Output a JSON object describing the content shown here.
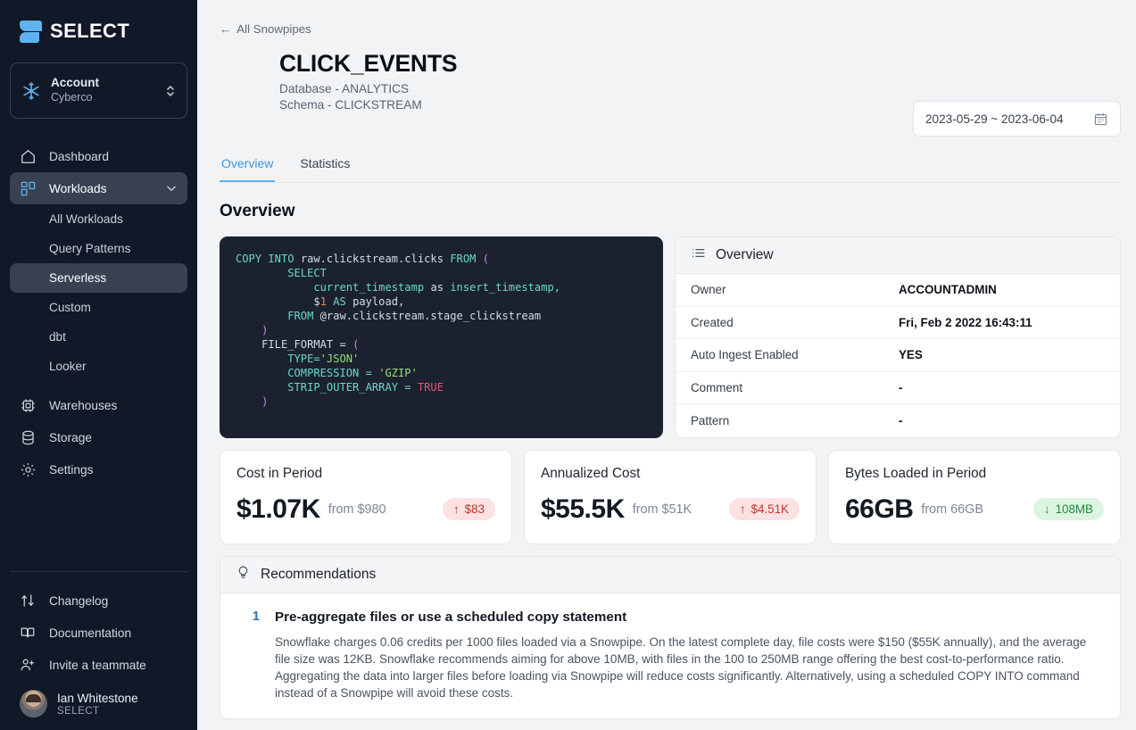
{
  "sidebar": {
    "brand": "SELECT",
    "account": {
      "title": "Account",
      "name": "Cyberco"
    },
    "nav": [
      {
        "label": "Dashboard",
        "icon": "home-icon"
      },
      {
        "label": "Workloads",
        "icon": "workloads-icon"
      }
    ],
    "workload_children": [
      {
        "label": "All Workloads"
      },
      {
        "label": "Query Patterns"
      },
      {
        "label": "Serverless"
      },
      {
        "label": "Custom"
      },
      {
        "label": "dbt"
      },
      {
        "label": "Looker"
      }
    ],
    "nav_rest": [
      {
        "label": "Warehouses",
        "icon": "chip-icon"
      },
      {
        "label": "Storage",
        "icon": "database-icon"
      },
      {
        "label": "Settings",
        "icon": "gear-icon"
      }
    ],
    "footer": [
      {
        "label": "Changelog",
        "icon": "updown-arrows-icon"
      },
      {
        "label": "Documentation",
        "icon": "book-icon"
      },
      {
        "label": "Invite a teammate",
        "icon": "user-plus-icon"
      }
    ],
    "user": {
      "name": "Ian Whitestone",
      "org": "SELECT"
    }
  },
  "header": {
    "back_label": "All Snowpipes",
    "title": "CLICK_EVENTS",
    "database_line": "Database - ANALYTICS",
    "schema_line": "Schema - CLICKSTREAM",
    "date_range": "2023-05-29 ~ 2023-06-04"
  },
  "tabs": [
    {
      "label": "Overview",
      "active": true
    },
    {
      "label": "Statistics",
      "active": false
    }
  ],
  "section": {
    "title": "Overview"
  },
  "code": {
    "lines": [
      [
        {
          "t": "COPY INTO ",
          "c": "k-key"
        },
        {
          "t": "raw.clickstream.clicks ",
          "c": "k-plain"
        },
        {
          "t": "FROM ",
          "c": "k-key"
        },
        {
          "t": "(",
          "c": "k-paren"
        }
      ],
      [
        {
          "t": "        SELECT",
          "c": "k-key"
        }
      ],
      [
        {
          "t": "            current_timestamp ",
          "c": "k-key"
        },
        {
          "t": "as ",
          "c": "k-plain"
        },
        {
          "t": "insert_timestamp,",
          "c": "k-key"
        }
      ],
      [
        {
          "t": "            $",
          "c": "k-plain"
        },
        {
          "t": "1 ",
          "c": "k-num"
        },
        {
          "t": "AS ",
          "c": "k-key"
        },
        {
          "t": "payload,",
          "c": "k-plain"
        }
      ],
      [
        {
          "t": "        FROM ",
          "c": "k-key"
        },
        {
          "t": "@raw.clickstream.stage_clickstream",
          "c": "k-plain"
        }
      ],
      [
        {
          "t": "    )",
          "c": "k-paren"
        }
      ],
      [
        {
          "t": "    FILE_FORMAT = ",
          "c": "k-plain"
        },
        {
          "t": "(",
          "c": "k-paren"
        }
      ],
      [
        {
          "t": "        TYPE=",
          "c": "k-key"
        },
        {
          "t": "'JSON'",
          "c": "k-str"
        }
      ],
      [
        {
          "t": "        COMPRESSION = ",
          "c": "k-key"
        },
        {
          "t": "'GZIP'",
          "c": "k-str"
        }
      ],
      [
        {
          "t": "        STRIP_OUTER_ARRAY = ",
          "c": "k-key"
        },
        {
          "t": "TRUE",
          "c": "k-bool"
        }
      ],
      [
        {
          "t": "    )",
          "c": "k-paren"
        }
      ]
    ]
  },
  "overview_panel": {
    "header": "Overview",
    "rows": [
      {
        "label": "Owner",
        "value": "ACCOUNTADMIN"
      },
      {
        "label": "Created",
        "value": "Fri, Feb 2 2022 16:43:11"
      },
      {
        "label": "Auto Ingest Enabled",
        "value": "YES"
      },
      {
        "label": "Comment",
        "value": "-"
      },
      {
        "label": "Pattern",
        "value": "-"
      }
    ]
  },
  "metrics": [
    {
      "label": "Cost in Period",
      "value": "$1.07K",
      "from": "from $980",
      "delta": "$83",
      "direction": "up",
      "arrow": "↑"
    },
    {
      "label": "Annualized Cost",
      "value": "$55.5K",
      "from": "from $51K",
      "delta": "$4.51K",
      "direction": "up",
      "arrow": "↑"
    },
    {
      "label": "Bytes Loaded in Period",
      "value": "66GB",
      "from": "from 66GB",
      "delta": "108MB",
      "direction": "down",
      "arrow": "↓"
    }
  ],
  "recommendations": {
    "header": "Recommendations",
    "items": [
      {
        "number": "1",
        "title": "Pre-aggregate files or use a scheduled copy statement",
        "description": "Snowflake charges 0.06 credits per 1000 files loaded via a Snowpipe. On the latest complete day, file costs were $150 ($55K annually), and the average file size was 12KB. Snowflake recommends aiming for above 10MB, with files in the 100 to 250MB range offering the best cost-to-performance ratio. Aggregating the data into larger files before loading via Snowpipe will reduce costs significantly. Alternatively, using a scheduled COPY INTO command instead of a Snowpipe will avoid these costs."
      }
    ]
  },
  "colors": {
    "accent": "#5fb2f0",
    "sidebar_bg": "#111827",
    "code_bg": "#1b212e",
    "up_badge_bg": "#fbe1e1",
    "up_badge_fg": "#c0392f",
    "down_badge_bg": "#dcf5e0",
    "down_badge_fg": "#1f8a3d"
  }
}
